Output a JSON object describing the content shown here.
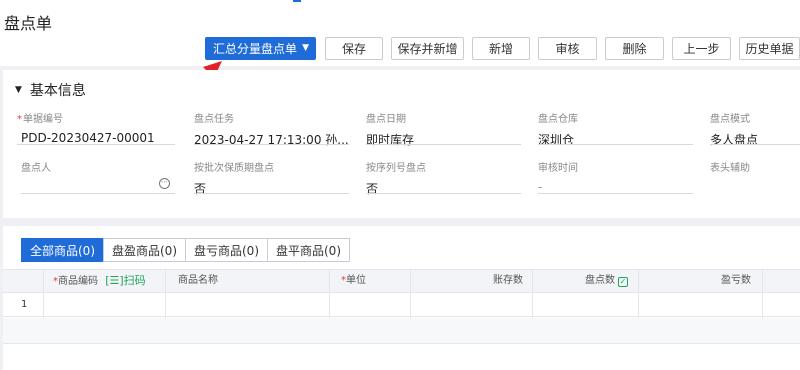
{
  "page": {
    "title": "盘点单"
  },
  "toolbar": {
    "buttons": [
      {
        "label": "汇总分量盘点单",
        "primary": true
      },
      {
        "label": "保存"
      },
      {
        "label": "保存并新增"
      },
      {
        "label": "新增"
      },
      {
        "label": "审核"
      },
      {
        "label": "删除"
      },
      {
        "label": "上一步"
      },
      {
        "label": "历史单据"
      }
    ]
  },
  "basic_info": {
    "title": "基本信息",
    "fields": [
      {
        "label": "单据编号",
        "value": "PDD-20230427-00001",
        "required": true
      },
      {
        "label": "盘点任务",
        "value": "2023-04-27 17:13:00  孙..."
      },
      {
        "label": "盘点日期",
        "value": "即时库存"
      },
      {
        "label": "盘点仓库",
        "value": "深圳仓"
      },
      {
        "label": "盘点模式",
        "value": "多人盘点"
      },
      {
        "label": "盘点人",
        "value": ""
      },
      {
        "label": "按批次保质期盘点",
        "value": "否"
      },
      {
        "label": "按序列号盘点",
        "value": "否"
      },
      {
        "label": "审核时间",
        "value": "-"
      },
      {
        "label": "表头辅助",
        "value": ""
      }
    ]
  },
  "tabs": [
    {
      "label": "全部商品(0)",
      "active": true
    },
    {
      "label": "盘盈商品(0)"
    },
    {
      "label": "盘亏商品(0)"
    },
    {
      "label": "盘平商品(0)"
    }
  ],
  "table": {
    "columns": [
      "商品编码",
      "商品名称",
      "单位",
      "账存数",
      "盘点数",
      "盈亏数"
    ],
    "scan_label": "扫码",
    "rows": [
      {
        "num": "1"
      }
    ]
  },
  "colors": {
    "accent": "#1f6bd8",
    "required": "#e23b3b",
    "scan": "#22a559",
    "arrow": "#e0202a"
  }
}
